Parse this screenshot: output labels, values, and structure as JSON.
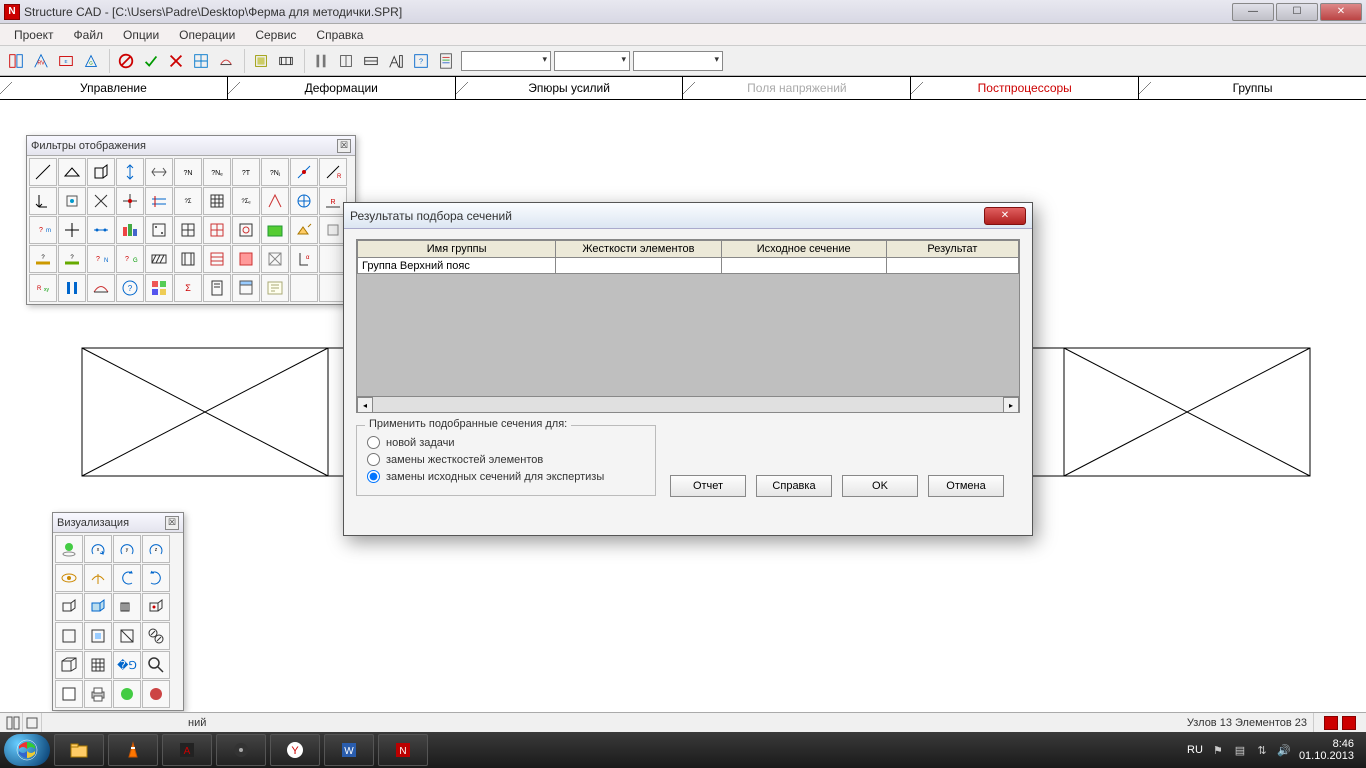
{
  "title": "Structure CAD  -  [C:\\Users\\Padre\\Desktop\\Ферма для методички.SPR]",
  "menu": {
    "items": [
      "Проект",
      "Файл",
      "Опции",
      "Операции",
      "Сервис",
      "Справка"
    ]
  },
  "tabs": [
    {
      "label": "Управление",
      "state": "normal"
    },
    {
      "label": "Деформации",
      "state": "normal"
    },
    {
      "label": "Эпюры усилий",
      "state": "normal"
    },
    {
      "label": "Поля напряжений",
      "state": "disabled"
    },
    {
      "label": "Постпроцессоры",
      "state": "active"
    },
    {
      "label": "Группы",
      "state": "normal"
    }
  ],
  "filters_palette": {
    "title": "Фильтры отображения"
  },
  "viz_palette": {
    "title": "Визуализация"
  },
  "dialog": {
    "title": "Результаты подбора сечений",
    "columns": [
      "Имя группы",
      "Жесткости элементов",
      "Исходное сечение",
      "Результат"
    ],
    "rows": [
      {
        "name": "Группа  Верхний пояс",
        "stiff": "",
        "section": "",
        "result": ""
      }
    ],
    "group_legend": "Применить подобранные сечения для:",
    "radios": [
      {
        "label": "новой задачи",
        "checked": false
      },
      {
        "label": "замены жесткостей элементов",
        "checked": false
      },
      {
        "label": "замены исходных сечений для экспертизы",
        "checked": true
      }
    ],
    "buttons": {
      "report": "Отчет",
      "help": "Справка",
      "ok": "OK",
      "cancel": "Отмена"
    }
  },
  "status": {
    "left_stub": "ний",
    "nodes": "Узлов 13 Элементов 23"
  },
  "tray": {
    "lang": "RU",
    "time": "8:46",
    "date": "01.10.2013"
  }
}
